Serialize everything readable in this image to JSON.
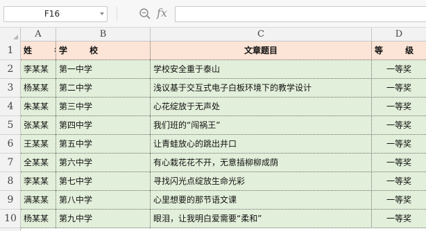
{
  "formula_bar": {
    "cell_ref": "F16",
    "zoom_icon": "magnifier-icon",
    "fx_label": "fx",
    "formula": ""
  },
  "columns": [
    "A",
    "B",
    "C",
    "D"
  ],
  "row_numbers": [
    "1",
    "2",
    "3",
    "4",
    "5",
    "6",
    "7",
    "8",
    "9",
    "10"
  ],
  "header": {
    "name": "姓 名",
    "school": "学 校",
    "title": "文章题目",
    "grade": "等 级"
  },
  "rows": [
    {
      "name": "李某某",
      "school": "第一中学",
      "title": "学校安全重于泰山",
      "grade": "一等奖"
    },
    {
      "name": "杨某某",
      "school": "第二中学",
      "title": "浅议基于交互式电子白板环境下的教学设计",
      "grade": "一等奖"
    },
    {
      "name": "朱某某",
      "school": "第三中学",
      "title": "心花绽放于无声处",
      "grade": "一等奖"
    },
    {
      "name": "张某某",
      "school": "第四中学",
      "title": "我们班的“闯祸王”",
      "grade": "一等奖"
    },
    {
      "name": "王某某",
      "school": "第五中学",
      "title": "让青蛙放心的跳出井口",
      "grade": "一等奖"
    },
    {
      "name": "全某某",
      "school": "第六中学",
      "title": "有心栽花花不开，无意插柳柳成荫",
      "grade": "一等奖"
    },
    {
      "name": "李某某",
      "school": "第七中学",
      "title": "寻找闪光点绽放生命光彩",
      "grade": "一等奖"
    },
    {
      "name": "满某某",
      "school": "第八中学",
      "title": "心里想要的那节语文课",
      "grade": "一等奖"
    },
    {
      "name": "杨某某",
      "school": "第九中学",
      "title": "眼泪，让我明白爱需要“柔和”",
      "grade": "一等奖"
    }
  ],
  "colors": {
    "header_fill": "#fce4d6",
    "body_fill": "#e2efda",
    "grid_header_bg": "#f2f2f2"
  }
}
